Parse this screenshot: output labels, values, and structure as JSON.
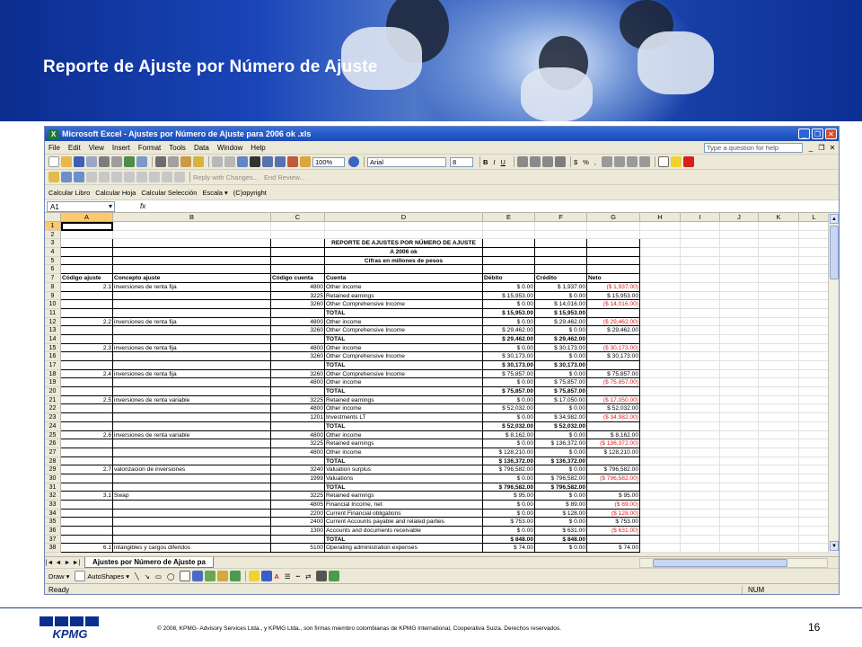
{
  "slide": {
    "title": "Reporte de Ajuste por Número de Ajuste",
    "copyright": "© 2008, KPMG- Advisory Services Ltda., y KPMG Ltda., son firmas miembro colombianas  de KPMG International, Cooperativa Suiza.  Derechos reservados.",
    "page_number": "16",
    "logo_text": "KPMG"
  },
  "excel": {
    "window_title": "Microsoft Excel - Ajustes por Número de Ajuste para 2006 ok .xls",
    "menu": [
      "File",
      "Edit",
      "View",
      "Insert",
      "Format",
      "Tools",
      "Data",
      "Window",
      "Help"
    ],
    "help_placeholder": "Type a question for help",
    "zoom": "100%",
    "font_name": "Arial",
    "font_size": "8",
    "reviewing": [
      "Reply with Changes...",
      "End Review..."
    ],
    "macro_buttons": [
      "Calcular Libro",
      "Calcular Hoja",
      "Calcular Selección",
      "Escala ▾",
      "(C)opyright"
    ],
    "name_box": "A1",
    "fx": "fx",
    "columns": [
      "A",
      "B",
      "C",
      "D",
      "E",
      "F",
      "G",
      "H",
      "I",
      "J",
      "K",
      "L"
    ],
    "sheet_tab": "Ajustes por Número de Ajuste pa",
    "draw_label": "Draw ▾",
    "autoshapes_label": "AutoShapes ▾",
    "status": "Ready",
    "status_num": "NUM"
  },
  "report": {
    "heading1": "REPORTE DE AJUSTES POR NÚMERO DE AJUSTE",
    "heading2": "A 2006 ok",
    "heading3": "Cifras en millones de pesos",
    "headers": [
      "Código ajuste",
      "Concepto ajuste",
      "Código cuenta",
      "Cuenta",
      "Débito",
      "Crédito",
      "Neto"
    ],
    "rows": [
      [
        "2.1",
        "inversiones de renta fija",
        "4800",
        "Other income",
        "$ 0.00",
        "$ 1,937.00",
        "($ 1,937.00)"
      ],
      [
        "",
        "",
        "3225",
        "Retained earnings",
        "$ 15,953.00",
        "$ 0.00",
        "$ 15,953.00"
      ],
      [
        "",
        "",
        "3260",
        "Other Comprehensive Income",
        "$ 0.00",
        "$ 14,016.00",
        "($ 14,016.00)"
      ],
      [
        "",
        "",
        "",
        "TOTAL",
        "$ 15,953.00",
        "$ 15,953.00",
        ""
      ],
      [
        "2.2",
        "inversiones de renta fija",
        "4800",
        "Other income",
        "$ 0.00",
        "$ 29,462.00",
        "($ 29,462.00)"
      ],
      [
        "",
        "",
        "3260",
        "Other Comprehensive Income",
        "$ 29,462.00",
        "$ 0.00",
        "$ 29,462.00"
      ],
      [
        "",
        "",
        "",
        "TOTAL",
        "$ 29,462.00",
        "$ 29,462.00",
        ""
      ],
      [
        "2.3",
        "inversiones de renta fija",
        "4800",
        "Other income",
        "$ 0.00",
        "$ 30,173.00",
        "($ 30,173.00)"
      ],
      [
        "",
        "",
        "3260",
        "Other Comprehensive Income",
        "$ 30,173.00",
        "$ 0.00",
        "$ 30,173.00"
      ],
      [
        "",
        "",
        "",
        "TOTAL",
        "$ 30,173.00",
        "$ 30,173.00",
        ""
      ],
      [
        "2.4",
        "inversiones de renta fija",
        "3260",
        "Other Comprehensive Income",
        "$ 75,857.00",
        "$ 0.00",
        "$ 75,857.00"
      ],
      [
        "",
        "",
        "4800",
        "Other income",
        "$ 0.00",
        "$ 75,857.00",
        "($ 75,857.00)"
      ],
      [
        "",
        "",
        "",
        "TOTAL",
        "$ 75,857.00",
        "$ 75,857.00",
        ""
      ],
      [
        "2.5",
        "inversiones de renta variable",
        "3225",
        "Retained earnings",
        "$ 0.00",
        "$ 17,050.00",
        "($ 17,050.00)"
      ],
      [
        "",
        "",
        "4800",
        "Other income",
        "$ 52,032.00",
        "$ 0.00",
        "$ 52,032.00"
      ],
      [
        "",
        "",
        "1201",
        "Investments LT",
        "$ 0.00",
        "$ 34,982.00",
        "($ 34,982.00)"
      ],
      [
        "",
        "",
        "",
        "TOTAL",
        "$ 52,032.00",
        "$ 52,032.00",
        ""
      ],
      [
        "2.6",
        "inversiones de renta variable",
        "4800",
        "Other income",
        "$ 8,162.00",
        "$ 0.00",
        "$ 8,162.00"
      ],
      [
        "",
        "",
        "3225",
        "Retained earnings",
        "$ 0.00",
        "$ 136,372.00",
        "($ 136,372.00)"
      ],
      [
        "",
        "",
        "4800",
        "Other income",
        "$ 128,210.00",
        "$ 0.00",
        "$ 128,210.00"
      ],
      [
        "",
        "",
        "",
        "TOTAL",
        "$ 136,372.00",
        "$ 136,372.00",
        ""
      ],
      [
        "2.7",
        "valorizacion de inversiones",
        "3240",
        "Valuation surplus",
        "$ 796,582.00",
        "$ 0.00",
        "$ 796,582.00"
      ],
      [
        "",
        "",
        "1999",
        "Valuations",
        "$ 0.00",
        "$ 796,582.00",
        "($ 796,582.00)"
      ],
      [
        "",
        "",
        "",
        "TOTAL",
        "$ 796,582.00",
        "$ 796,582.00",
        ""
      ],
      [
        "3.1",
        "Swap",
        "3225",
        "Retained earnings",
        "$ 95.00",
        "$ 0.00",
        "$ 95.00"
      ],
      [
        "",
        "",
        "4805",
        "Financial Income, net",
        "$ 0.00",
        "$ 89.00",
        "($ 89.00)"
      ],
      [
        "",
        "",
        "2200",
        "Current Financial obligations",
        "$ 0.00",
        "$ 128.00",
        "($ 128.00)"
      ],
      [
        "",
        "",
        "2400",
        "Current Accounts payable and related parties",
        "$ 753.00",
        "$ 0.00",
        "$ 753.00"
      ],
      [
        "",
        "",
        "1300",
        "Accounts and documents receivable",
        "$ 0.00",
        "$ 631.00",
        "($ 631.00)"
      ],
      [
        "",
        "",
        "",
        "TOTAL",
        "$ 848.00",
        "$ 848.00",
        ""
      ],
      [
        "6.1",
        "intangibles y cargos diferidos",
        "5100",
        "Operating administration expenses",
        "$ 74.00",
        "$ 0.00",
        "$ 74.00"
      ]
    ]
  }
}
